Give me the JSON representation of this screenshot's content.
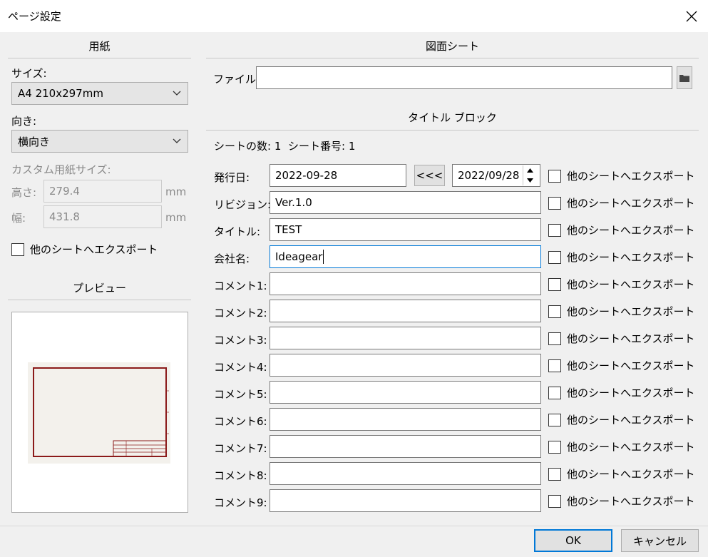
{
  "dialog": {
    "title": "ページ設定"
  },
  "paper": {
    "section_title": "用紙",
    "size_label": "サイズ:",
    "size_value": "A4 210x297mm",
    "orientation_label": "向き:",
    "orientation_value": "横向き",
    "custom_size_label": "カスタム用紙サイズ:",
    "height_label": "高さ:",
    "height_value": "279.4",
    "height_unit": "mm",
    "width_label": "幅:",
    "width_value": "431.8",
    "width_unit": "mm",
    "export_label": "他のシートへエクスポート"
  },
  "preview": {
    "section_title": "プレビュー"
  },
  "drawing_sheet": {
    "section_title": "図面シート",
    "file_label": "ファイル:",
    "file_value": ""
  },
  "title_block": {
    "section_title": "タイトル ブロック",
    "sheet_count": "シートの数: 1",
    "sheet_number": "シート番号: 1",
    "export_label": "他のシートへエクスポート",
    "date_copy_label": "<<<",
    "date_picker_value": "2022/09/28",
    "fields": [
      {
        "label": "発行日:",
        "value": "2022-09-28"
      },
      {
        "label": "リビジョン:",
        "value": "Ver.1.0"
      },
      {
        "label": "タイトル:",
        "value": "TEST"
      },
      {
        "label": "会社名:",
        "value": "Ideagear"
      },
      {
        "label": "コメント1:",
        "value": ""
      },
      {
        "label": "コメント2:",
        "value": ""
      },
      {
        "label": "コメント3:",
        "value": ""
      },
      {
        "label": "コメント4:",
        "value": ""
      },
      {
        "label": "コメント5:",
        "value": ""
      },
      {
        "label": "コメント6:",
        "value": ""
      },
      {
        "label": "コメント7:",
        "value": ""
      },
      {
        "label": "コメント8:",
        "value": ""
      },
      {
        "label": "コメント9:",
        "value": ""
      }
    ]
  },
  "buttons": {
    "ok": "OK",
    "cancel": "キャンセル"
  },
  "colors": {
    "accent": "#0078d7",
    "sheet_border": "#8b1a1a",
    "sheet_fill": "#f3f1ec"
  }
}
